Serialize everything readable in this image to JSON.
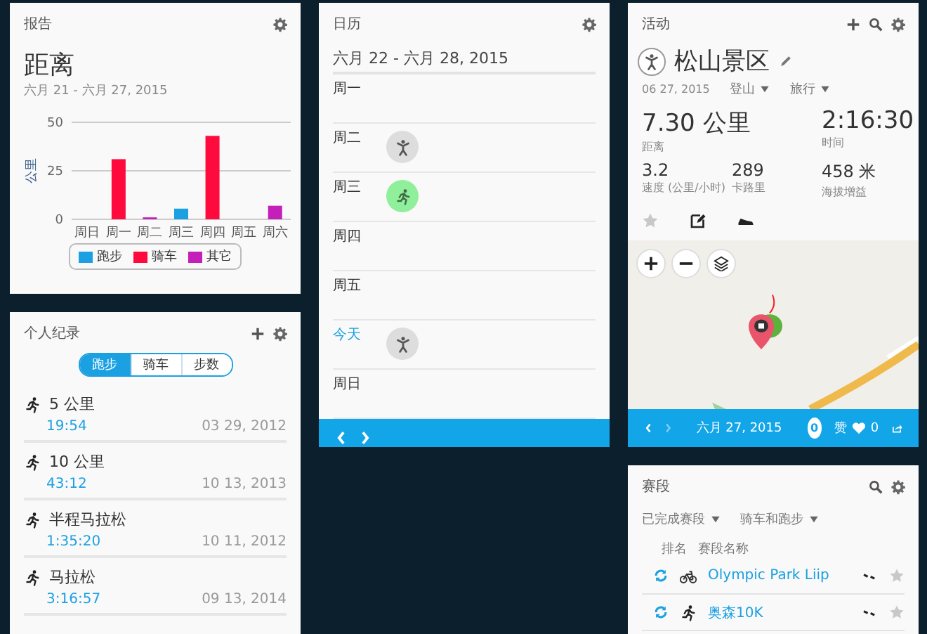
{
  "report": {
    "title": "报告",
    "metric": "距离",
    "range": "六月 21 - 六月 27, 2015",
    "chart_data": {
      "type": "bar",
      "ylabel": "公里",
      "stacked": true,
      "categories": [
        "周日",
        "周一",
        "周二",
        "周三",
        "周四",
        "周五",
        "周六"
      ],
      "yticks": [
        0,
        25,
        50
      ],
      "ylim": [
        0,
        50
      ],
      "series": [
        {
          "name": "跑步",
          "color": "#1ba1e2",
          "values": [
            null,
            null,
            null,
            5.5,
            null,
            null,
            null
          ]
        },
        {
          "name": "骑车",
          "color": "#ff0a3c",
          "values": [
            null,
            31,
            null,
            null,
            43,
            null,
            null
          ]
        },
        {
          "name": "其它",
          "color": "#c41fb8",
          "values": [
            null,
            null,
            1,
            null,
            null,
            null,
            7
          ]
        }
      ]
    }
  },
  "records": {
    "title": "个人纪录",
    "tabs": [
      {
        "label": "跑步",
        "selected": true
      },
      {
        "label": "骑车",
        "selected": false
      },
      {
        "label": "步数",
        "selected": false
      }
    ],
    "items": [
      {
        "name": "5 公里",
        "time": "19:54",
        "date": "03 29, 2012"
      },
      {
        "name": "10 公里",
        "time": "43:12",
        "date": "10 13, 2013"
      },
      {
        "name": "半程马拉松",
        "time": "1:35:20",
        "date": "10 11, 2012"
      },
      {
        "name": "马拉松",
        "time": "3:16:57",
        "date": "09 13, 2014"
      }
    ]
  },
  "calendar": {
    "title": "日历",
    "range": "六月 22 - 六月 28, 2015",
    "days": [
      {
        "label": "周一",
        "today": false
      },
      {
        "label": "周二",
        "today": false,
        "kind": "hike"
      },
      {
        "label": "周三",
        "today": false,
        "kind": "run"
      },
      {
        "label": "周四",
        "today": false
      },
      {
        "label": "周五",
        "today": false
      },
      {
        "label": "今天",
        "today": true,
        "kind": "hike"
      },
      {
        "label": "周日",
        "today": false
      }
    ]
  },
  "activity": {
    "title": "活动",
    "name": "松山景区",
    "date": "06 27, 2015",
    "tags": [
      "登山",
      "旅行"
    ],
    "stats_main": [
      {
        "value": "7.30 公里",
        "label": "距离"
      },
      {
        "value": "2:16:30",
        "label": "时间"
      }
    ],
    "stats": [
      {
        "value": "3.2",
        "label": "速度 (公里/小时)"
      },
      {
        "value": "289",
        "label": "卡路里"
      },
      {
        "value": "458 米",
        "label": "海拔增益"
      }
    ],
    "starred": false,
    "footer": {
      "date": "六月 27, 2015",
      "comments": "0",
      "like_label": "赞",
      "likes": "0",
      "next_disabled": true
    }
  },
  "segments": {
    "title": "赛段",
    "filters": [
      "已完成赛段",
      "骑车和跑步"
    ],
    "columns": [
      "排名",
      "赛段名称"
    ],
    "rows": [
      {
        "kind": "bike",
        "name": "Olympic Park Liip",
        "starred": false
      },
      {
        "kind": "run",
        "name": "奥森10K",
        "starred": false
      }
    ]
  }
}
